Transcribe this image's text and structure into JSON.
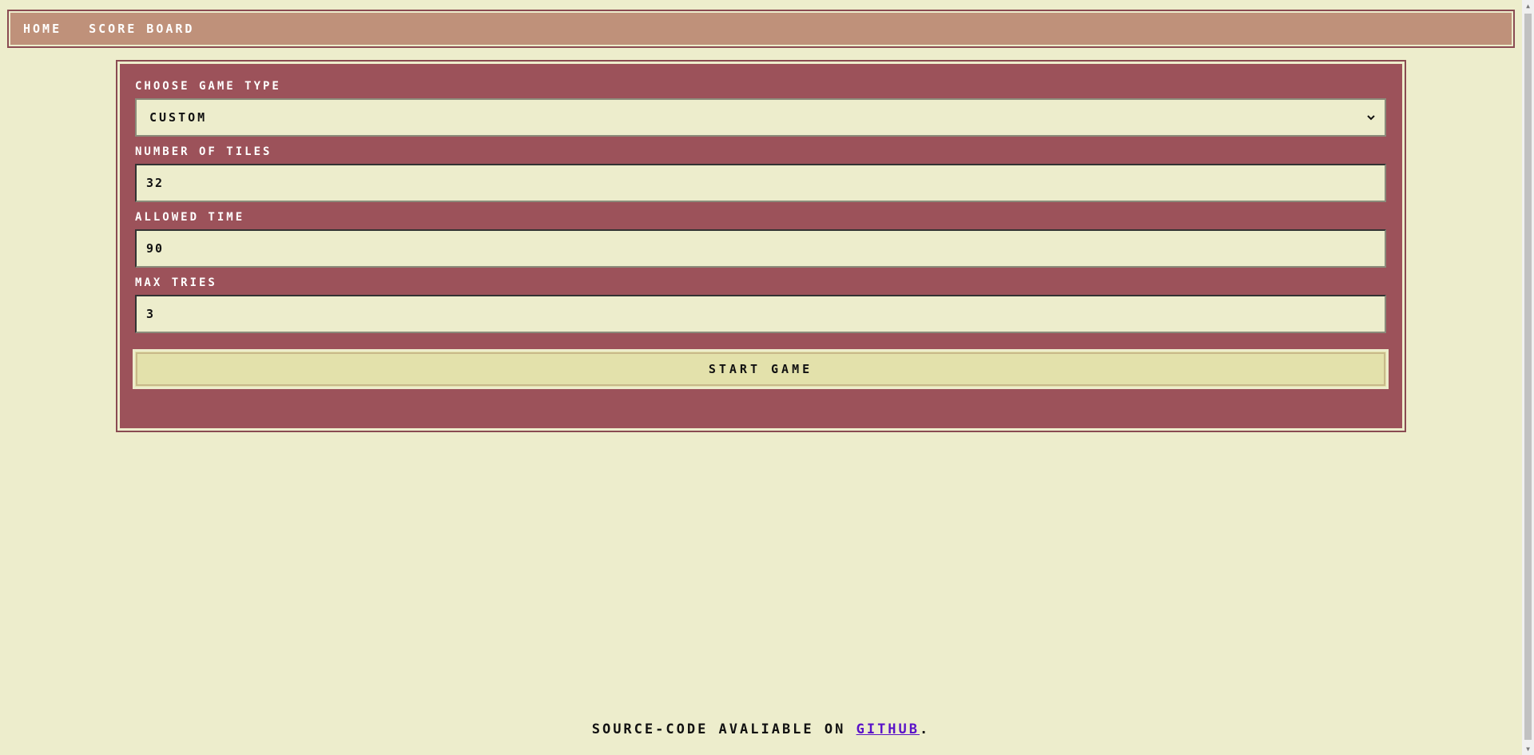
{
  "nav": {
    "items": [
      {
        "label": "HOME"
      },
      {
        "label": "SCORE BOARD"
      }
    ]
  },
  "form": {
    "game_type_label": "CHOOSE GAME TYPE",
    "game_type_value": "CUSTOM",
    "tiles_label": "NUMBER OF TILES",
    "tiles_value": "32",
    "time_label": "ALLOWED TIME",
    "time_value": "90",
    "tries_label": "MAX TRIES",
    "tries_value": "3",
    "start_label": "START GAME"
  },
  "footer": {
    "text_before": "SOURCE-CODE AVALIABLE ON ",
    "link_label": "GITHUB",
    "text_after": "."
  },
  "colors": {
    "background": "#ededcc",
    "navbar": "#bf917a",
    "panel": "#9c525a",
    "button": "#e3e1ab",
    "link": "#5a12c8"
  },
  "icons": {
    "select": "chevron-down-icon"
  }
}
